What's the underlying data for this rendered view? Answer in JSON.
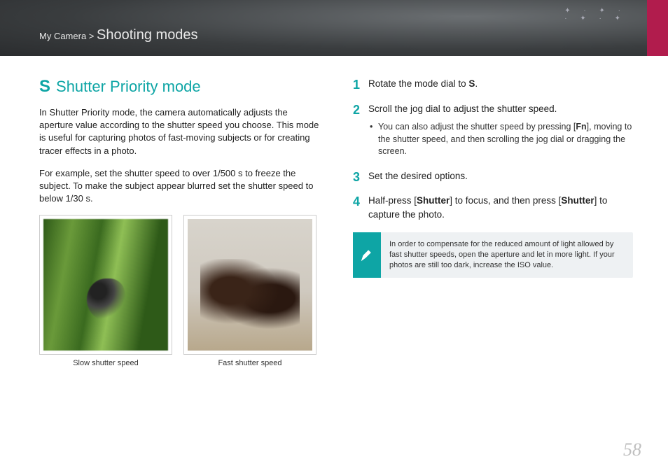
{
  "breadcrumb": {
    "parent": "My Camera",
    "separator": " > ",
    "section": "Shooting modes"
  },
  "title": {
    "icon": "S",
    "text": "Shutter Priority mode"
  },
  "intro_p1": "In Shutter Priority mode, the camera automatically adjusts the aperture value according to the shutter speed you choose. This mode is useful for capturing photos of fast-moving subjects or for creating tracer effects in a photo.",
  "intro_p2": "For example, set the shutter speed to over 1/500 s to freeze the subject. To make the subject appear blurred set the shutter speed to below 1/30 s.",
  "examples": {
    "slow": {
      "caption": "Slow shutter speed"
    },
    "fast": {
      "caption": "Fast shutter speed"
    }
  },
  "steps": [
    {
      "pre": "Rotate the mode dial to ",
      "glyph": "S",
      "post": "."
    },
    {
      "text": "Scroll the jog dial to adjust the shutter speed.",
      "sub": {
        "pre": "You can also adjust the shutter speed by pressing [",
        "glyph": "Fn",
        "post": "], moving to the shutter speed, and then scrolling the jog dial or dragging the screen."
      }
    },
    {
      "text": "Set the desired options."
    },
    {
      "pre": "Half-press [",
      "b1": "Shutter",
      "mid": "] to focus, and then press [",
      "b2": "Shutter",
      "post": "] to capture the photo."
    }
  ],
  "note": "In order to compensate for the reduced amount of light allowed by fast shutter speeds, open the aperture and let in more light. If your photos are still too dark, increase the ISO value.",
  "page_number": "58"
}
